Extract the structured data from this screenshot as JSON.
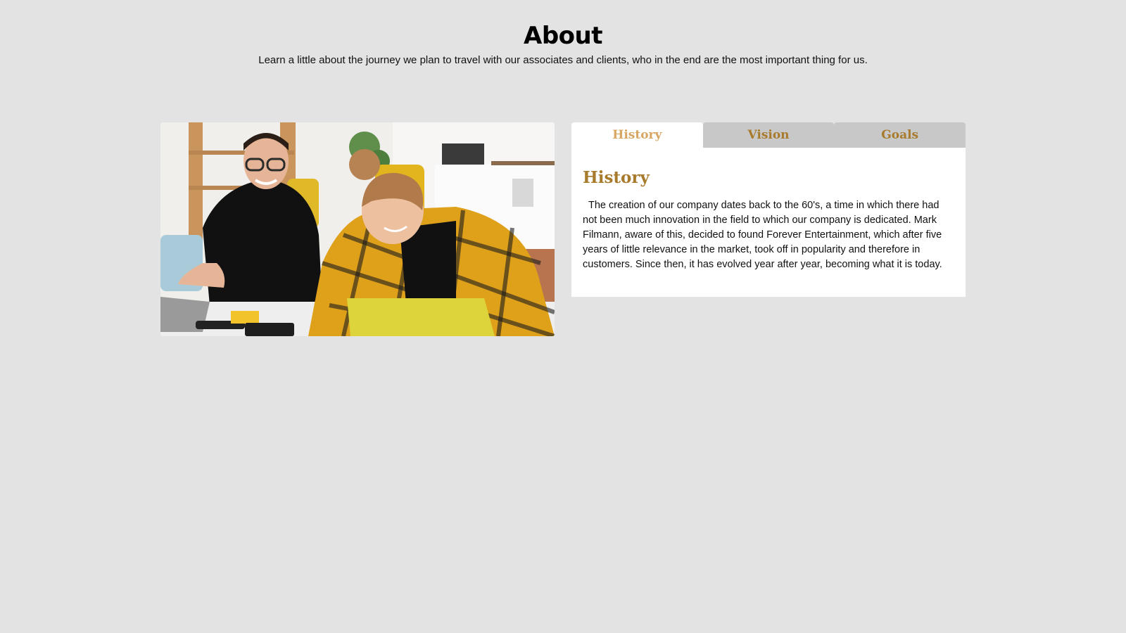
{
  "header": {
    "title": "About",
    "subtitle": "Learn a little about the journey we plan to travel with our associates and clients, who in the end are the most important thing for us."
  },
  "tabs": [
    {
      "label": "History",
      "active": true
    },
    {
      "label": "Vision",
      "active": false
    },
    {
      "label": "Goals",
      "active": false
    }
  ],
  "content": {
    "title": "History",
    "text": "The creation of our company dates back to the 60's, a time in which there had not been much innovation in the field to which our company is dedicated. Mark Filmann, aware of this, decided to found Forever Entertainment, which after five years of little relevance in the market, took off in popularity and therefore in customers. Since then, it has evolved year after year, becoming what it is today."
  },
  "colors": {
    "background": "#e3e3e3",
    "accent": "#a87a2c",
    "accent_light": "#d8a562",
    "tab_inactive": "#c8c8c8"
  }
}
